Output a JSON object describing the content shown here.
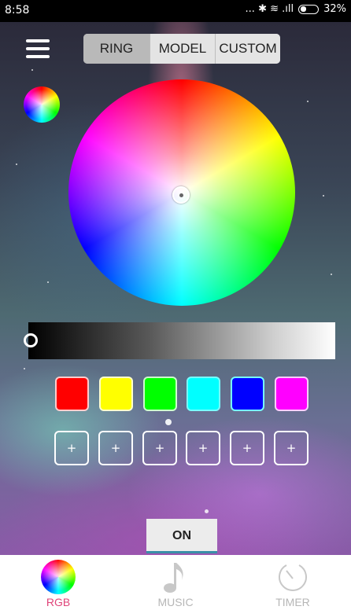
{
  "status_bar": {
    "time": "8:58",
    "signal_text": "... ✱ ≋ .ıll",
    "battery": "32%"
  },
  "header": {
    "tabs": [
      {
        "label": "RING",
        "selected": true
      },
      {
        "label": "MODEL",
        "selected": false
      },
      {
        "label": "CUSTOM",
        "selected": false
      }
    ]
  },
  "presets": {
    "colors": [
      "#ff0000",
      "#ffff00",
      "#00ff00",
      "#00ffff",
      "#0000ff",
      "#ff00ff"
    ],
    "custom_slots": [
      "+",
      "+",
      "+",
      "+",
      "+",
      "+"
    ]
  },
  "power": {
    "label": "ON"
  },
  "bottom_nav": {
    "items": [
      {
        "label": "RGB",
        "icon": "rgb-wheel-icon",
        "active": true
      },
      {
        "label": "MUSIC",
        "icon": "music-note-icon",
        "active": false
      },
      {
        "label": "TIMER",
        "icon": "timer-icon",
        "active": false
      }
    ]
  },
  "colors": {
    "accent": "#e0457a",
    "inactive": "#b6b6b6",
    "on_button_underline": "#3a8fa8"
  }
}
